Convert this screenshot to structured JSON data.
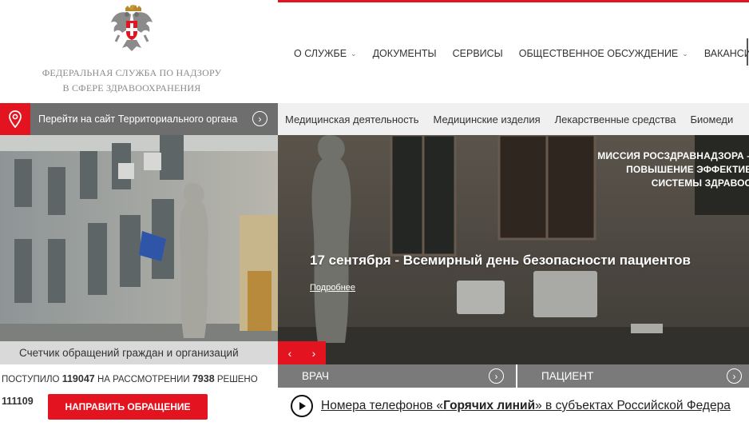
{
  "header": {
    "org_line1": "ФЕДЕРАЛЬНАЯ СЛУЖБА ПО НАДЗОРУ",
    "org_line2": "В СФЕРЕ ЗДРАВООХРАНЕНИЯ",
    "nav": [
      {
        "label": "О СЛУЖБЕ",
        "dropdown": true
      },
      {
        "label": "ДОКУМЕНТЫ",
        "dropdown": false
      },
      {
        "label": "СЕРВИСЫ",
        "dropdown": false
      },
      {
        "label": "ОБЩЕСТВЕННОЕ ОБСУЖДЕНИЕ",
        "dropdown": true
      },
      {
        "label": "ВАКАНСИИ",
        "dropdown": false
      }
    ]
  },
  "territory": {
    "label": "Перейти на сайт Территориального органа"
  },
  "categories": [
    "Медицинская деятельность",
    "Медицинские изделия",
    "Лекарственные средства",
    "Биомеди"
  ],
  "hero": {
    "mission_line1": "МИССИЯ РОСЗДРАВНАДЗОРА –",
    "mission_line2": "ПОВЫШЕНИЕ ЭФФЕКТИВ",
    "mission_line3": "СИСТЕМЫ ЗДРАВОО",
    "headline": "17 сентября - Всемирный день безопасности пациентов",
    "more_link": "Подробнее"
  },
  "counter": {
    "title": "Счетчик обращений граждан и организаций",
    "received_label": "ПОСТУПИЛО",
    "received_value": "119047",
    "review_label": "НА РАССМОТРЕНИИ",
    "review_value": "7938",
    "resolved_label": "РЕШЕНО",
    "resolved_value": "111109",
    "button": "НАПРАВИТЬ ОБРАЩЕНИЕ"
  },
  "roles": {
    "doctor": "ВРАЧ",
    "patient": "ПАЦИЕНТ"
  },
  "hotline": {
    "prefix": "Номера телефонов «",
    "bold": "Горячих линий",
    "suffix": "» в субъектах Российской Федера"
  },
  "colors": {
    "accent": "#e3141f",
    "bar_gray": "#6e6e6e",
    "category_bg": "#f0f0f0"
  },
  "icons": [
    "emblem-icon",
    "location-pin-icon",
    "arrow-right-circle-icon",
    "chevron-left-icon",
    "chevron-right-icon",
    "play-icon"
  ]
}
